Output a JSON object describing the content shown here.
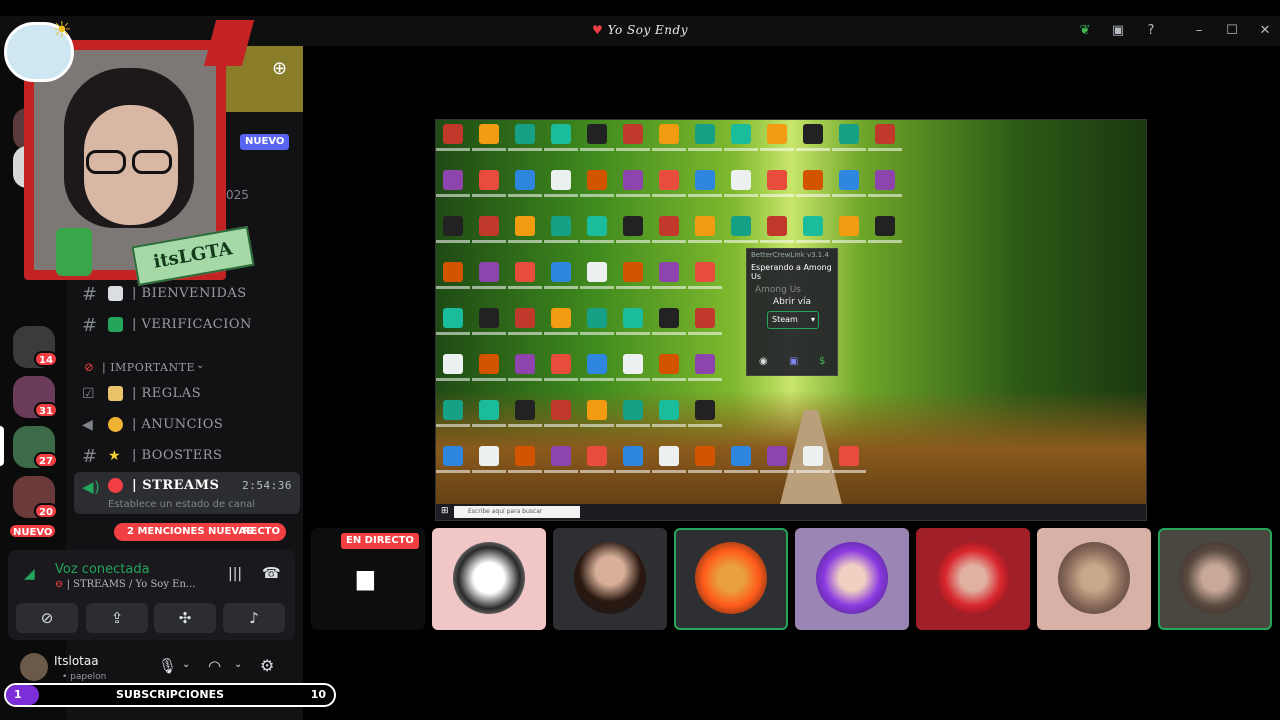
{
  "window": {
    "title": "Yo Soy Endy",
    "icons": [
      "back-arrow-icon",
      "leaf-icon",
      "inbox-icon",
      "help-icon",
      "minimize-icon",
      "maximize-icon",
      "close-icon"
    ]
  },
  "rail": {
    "badges": [
      "14",
      "31",
      "27",
      "20"
    ],
    "nuevo_label": "NUEVO"
  },
  "webcam": {
    "name_tag": "itsLGTA"
  },
  "channel_header": {
    "nuevo_label": "NUEVO",
    "date_fragment": "025"
  },
  "channels": {
    "bienvenidas": "| BIENVENIDAS",
    "verificacion": "| VERIFICACION",
    "category_importante": "| IMPORTANTE",
    "reglas": "| REGLAS",
    "anuncios": "| ANUNCIOS",
    "boosters": "| BOOSTERS",
    "streams": "| STREAMS",
    "streams_timer": "2:54:36",
    "status_placeholder": "Establece un estado de canal",
    "mentions_pill": "2 MENCIONES NUEVAS",
    "directo_fragment": "RECTO"
  },
  "voice": {
    "status": "Voz conectada",
    "channel": "| STREAMS / Yo Soy En..."
  },
  "user": {
    "name": "Itslotaa",
    "status": "• papelon"
  },
  "stream_overlay": {
    "launcher_title": "BetterCrewLink v3.1.4",
    "waiting": "Esperando a Among Us",
    "game": "Among Us",
    "open_via": "Abrir vía",
    "platform": "Steam",
    "search_placeholder": "Escribe aquí para buscar"
  },
  "participants": {
    "live_badge": "EN DIRECTO"
  },
  "subscriptions": {
    "label": "SUBSCRIPCIONES",
    "current": "1",
    "goal": "10",
    "progress": 0.1
  },
  "colors": {
    "accent": "#5865f2",
    "danger": "#f23f43",
    "online": "#23a55a",
    "sub_progress": "#7c2fd6"
  }
}
